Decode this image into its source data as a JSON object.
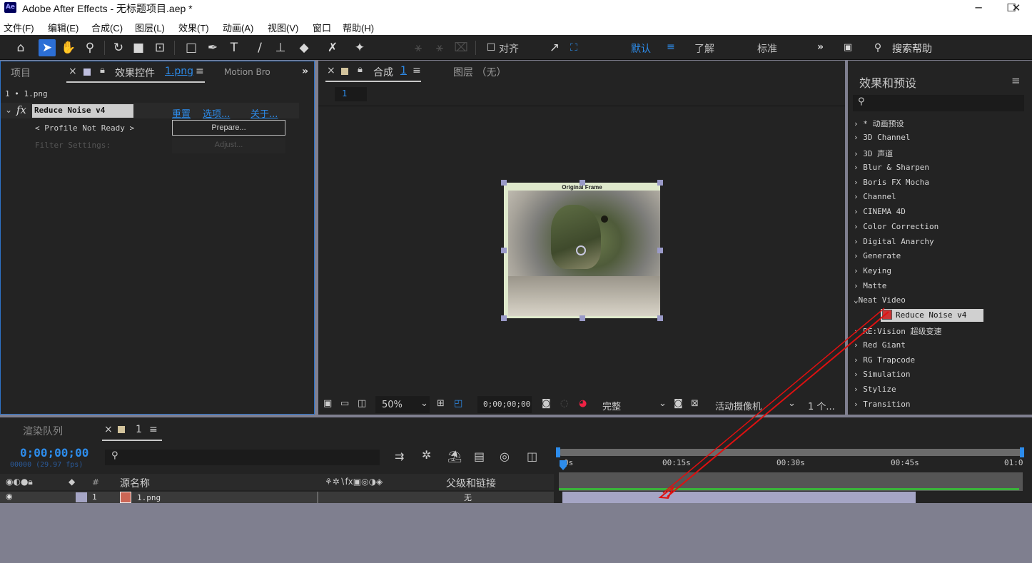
{
  "window": {
    "app_icon": "Ae",
    "title": "Adobe After Effects - 无标题项目.aep *",
    "minimize": "─",
    "maximize": "☐",
    "close": "✕"
  },
  "menu": [
    "文件(F)",
    "编辑(E)",
    "合成(C)",
    "图层(L)",
    "效果(T)",
    "动画(A)",
    "视图(V)",
    "窗口",
    "帮助(H)"
  ],
  "toolbar": {
    "align_label": "对齐",
    "workspaces": [
      "默认",
      "了解",
      "标准"
    ],
    "more": "»",
    "search_help": "搜索帮助"
  },
  "left_panel": {
    "tab_project": "项目",
    "tab_effect_controls_prefix": "效果控件",
    "tab_effect_controls_file": "1.png",
    "tab_motion": "Motion Bro",
    "layer_path": "1 • 1.png",
    "effect_name": "Reduce Noise v4",
    "reset": "重置",
    "options": "选项...",
    "about": "关于...",
    "profile_status": "< Profile Not Ready >",
    "prepare_button": "Prepare...",
    "filter_settings": "Filter Settings:",
    "adjust_button": "Adjust..."
  },
  "comp_panel": {
    "tab_comp_prefix": "合成",
    "tab_comp_name": "1",
    "tab_layer": "图层 （无）",
    "comp_chip": "1",
    "frame_label": "Original Frame",
    "zoom": "50%",
    "timecode": "0;00;00;00",
    "quality": "完整",
    "camera": "活动摄像机",
    "views": "1 个..."
  },
  "effects_panel": {
    "title": "效果和预设",
    "search_placeholder": "",
    "items": [
      "› * 动画预设",
      "› 3D Channel",
      "› 3D 声道",
      "› Blur & Sharpen",
      "› Boris FX Mocha",
      "› Channel",
      "› CINEMA 4D",
      "› Color Correction",
      "› Digital Anarchy",
      "› Generate",
      "› Keying",
      "› Matte",
      "⌄Neat Video",
      "Reduce Noise v4",
      "› RE:Vision 超级变速",
      "› Red Giant",
      "› RG Trapcode",
      "› Simulation",
      "› Stylize",
      "› Transition"
    ]
  },
  "timeline": {
    "tab_render": "渲染队列",
    "tab_comp": "1",
    "timecode": "0;00;00;00",
    "frame_info": "00000 (29.97 fps)",
    "ruler": [
      "0s",
      "00:15s",
      "00:30s",
      "00:45s",
      "01:0"
    ],
    "col_hash": "#",
    "col_source": "源名称",
    "col_parent": "父级和链接",
    "layer_number": "1",
    "layer_name": "1.png",
    "parent_value": "无"
  },
  "colors": {
    "accent_blue": "#2d8ceb",
    "panel_bg": "#232323",
    "arrow_red": "#e01010",
    "layer_bar": "#a5a5c5"
  }
}
